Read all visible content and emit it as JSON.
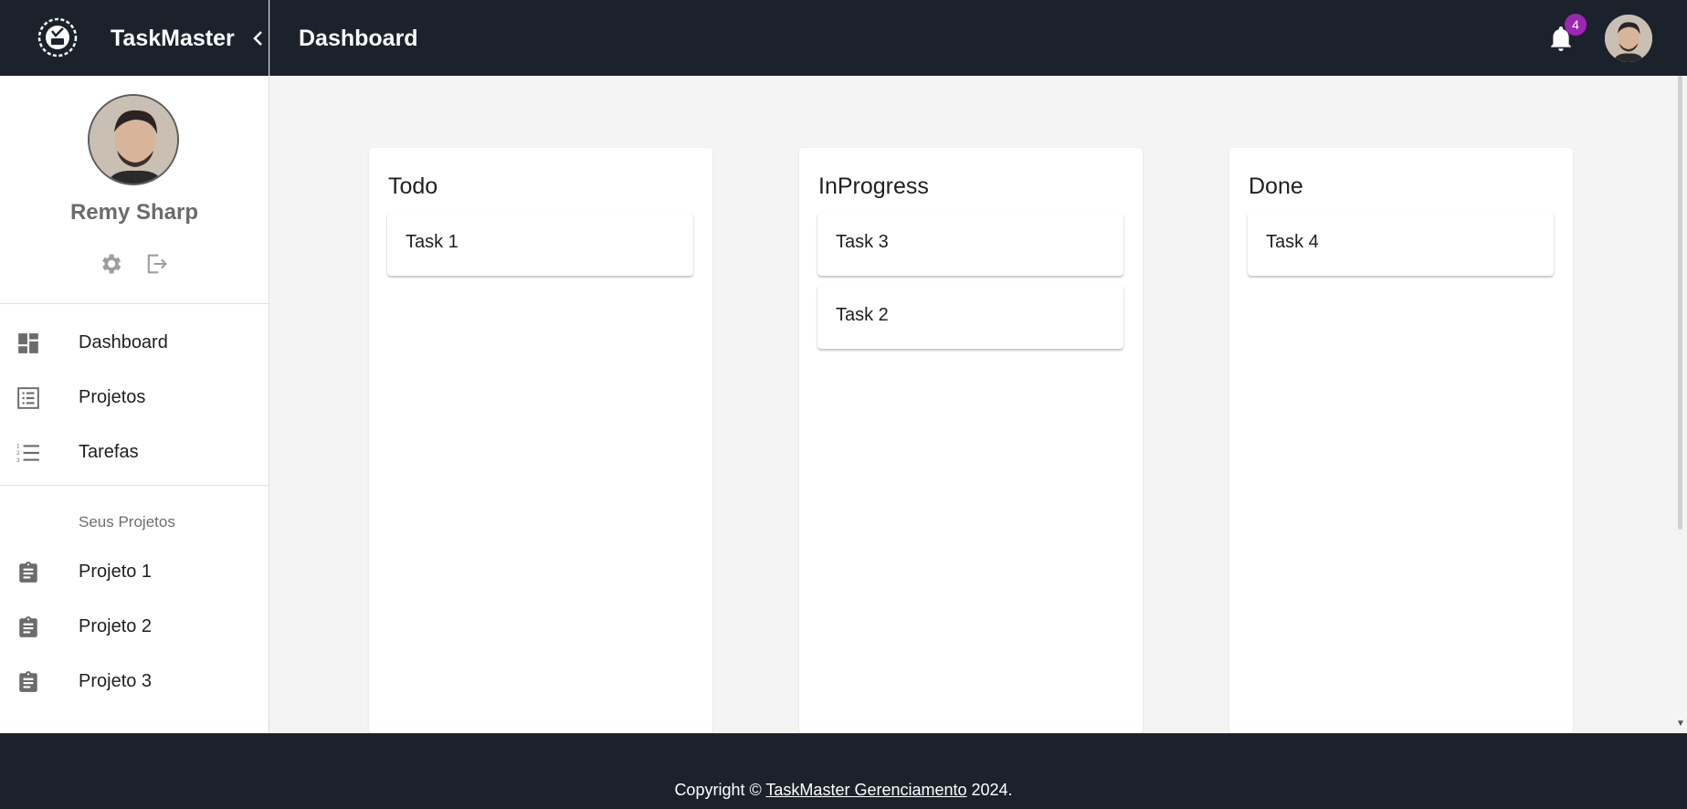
{
  "brand": {
    "name": "TaskMaster"
  },
  "header": {
    "title": "Dashboard",
    "notification_count": "4"
  },
  "user": {
    "name": "Remy Sharp"
  },
  "nav": {
    "items": [
      {
        "label": "Dashboard",
        "icon": "dashboard-icon"
      },
      {
        "label": "Projetos",
        "icon": "list-alt-icon"
      },
      {
        "label": "Tarefas",
        "icon": "format-list-numbered-icon"
      }
    ],
    "section_title": "Seus Projetos",
    "projects": [
      {
        "label": "Projeto 1",
        "icon": "assignment-icon"
      },
      {
        "label": "Projeto 2",
        "icon": "assignment-icon"
      },
      {
        "label": "Projeto 3",
        "icon": "assignment-icon"
      }
    ]
  },
  "board": {
    "columns": [
      {
        "title": "Todo",
        "tasks": [
          "Task 1"
        ]
      },
      {
        "title": "InProgress",
        "tasks": [
          "Task 3",
          "Task 2"
        ]
      },
      {
        "title": "Done",
        "tasks": [
          "Task 4"
        ]
      }
    ]
  },
  "footer": {
    "prefix": "Copyright © ",
    "link": "TaskMaster Gerenciamento",
    "suffix": " 2024."
  },
  "colors": {
    "topbar": "#1b222c",
    "background": "#f4f4f4",
    "badge": "#9c27b0",
    "icon_gray": "#6b6b6b"
  }
}
